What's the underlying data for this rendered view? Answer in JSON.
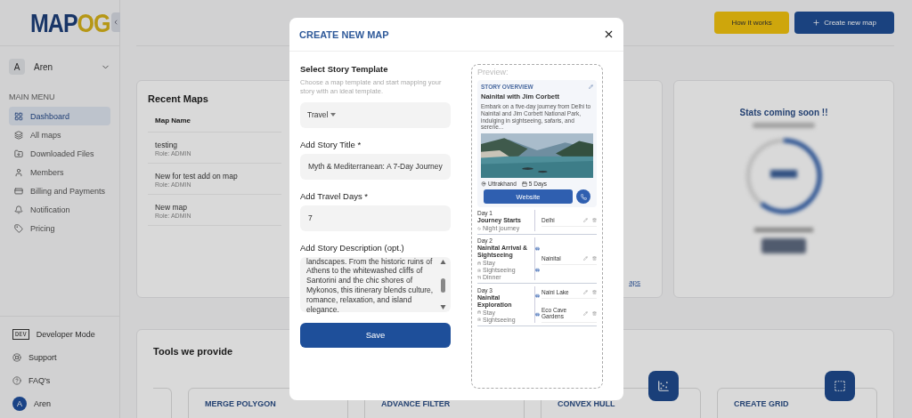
{
  "logo": {
    "main": "MAP",
    "accent": "OG"
  },
  "sidebar": {
    "user": {
      "initial": "A",
      "name": "Aren"
    },
    "section": "MAIN MENU",
    "items": [
      {
        "label": "Dashboard",
        "selected": true
      },
      {
        "label": "All maps",
        "selected": false
      },
      {
        "label": "Downloaded Files",
        "selected": false
      },
      {
        "label": "Members",
        "selected": false
      },
      {
        "label": "Billing and Payments",
        "selected": false
      },
      {
        "label": "Notification",
        "selected": false
      },
      {
        "label": "Pricing",
        "selected": false
      }
    ],
    "bottom": [
      {
        "label": "Developer Mode",
        "kind": "badge",
        "badge": "DEV"
      },
      {
        "label": "Support",
        "kind": "icon"
      },
      {
        "label": "FAQ's",
        "kind": "icon"
      },
      {
        "label": "Aren",
        "kind": "avatar",
        "badge": "A"
      }
    ]
  },
  "header": {
    "buttons": [
      {
        "label": "How it works",
        "kind": "secondary"
      },
      {
        "label": "Create new map",
        "kind": "primary"
      }
    ]
  },
  "recent_maps": {
    "title": "Recent Maps",
    "column": "Map Name",
    "rows": [
      {
        "name": "testing",
        "role": "Role: ADMIN"
      },
      {
        "name": "New for test add on map",
        "role": "Role: ADMIN"
      },
      {
        "name": "New map",
        "role": "Role: ADMIN"
      }
    ],
    "link": "aps"
  },
  "stats": {
    "title": "Stats coming soon !!"
  },
  "tools": {
    "title": "Tools we provide",
    "items": [
      {
        "name": "MERGE POLYGON"
      },
      {
        "name": "ADVANCE FILTER"
      },
      {
        "name": "CONVEX HULL"
      },
      {
        "name": "CREATE GRID"
      }
    ]
  },
  "modal": {
    "title": "CREATE NEW MAP",
    "template": {
      "label": "Select Story Template",
      "hint": "Choose a map template and start mapping your story with an ideal template.",
      "value": "Travel"
    },
    "fields": [
      {
        "label": "Add Story Title *",
        "value": "Myth & Mediterranean: A 7-Day Journey"
      },
      {
        "label": "Add Travel Days *",
        "value": "7"
      }
    ],
    "description": {
      "label": "Add Story Description (opt.)",
      "value": "landscapes. From the historic ruins of Athens to the whitewashed cliffs of Santorini and the chic shores of Mykonos, this itinerary blends culture, romance, relaxation, and island elegance."
    },
    "save": "Save",
    "preview": {
      "label": "Preview:",
      "overview": "STORY OVERVIEW",
      "title": "Nainital with Jim Corbett",
      "text": "Embark on a five-day journey from Delhi to Nainital and Jim Corbett National Park, indulging in sightseeing, safaris, and serene...",
      "location": "Uttrakhand",
      "duration": "5 Days",
      "button": "Website",
      "days": [
        {
          "day": "Day 1",
          "title": "Journey Starts",
          "tags": [
            {
              "label": "Night journey",
              "kind": "travel"
            }
          ],
          "stops": [
            "Delhi"
          ]
        },
        {
          "day": "Day 2",
          "title": "Nainital Arrival & Sightseeing",
          "tags": [
            {
              "label": "Stay",
              "kind": "stay"
            },
            {
              "label": "Sightseeing",
              "kind": "sightseeing"
            },
            {
              "label": "Dinner",
              "kind": "meal"
            }
          ],
          "stops": [
            "Nainital"
          ]
        },
        {
          "day": "Day 3",
          "title": "Nainital Exploration",
          "tags": [
            {
              "label": "Stay",
              "kind": "stay"
            },
            {
              "label": "Sightseeing",
              "kind": "sightseeing"
            }
          ],
          "stops": [
            "Naini Lake",
            "Eco Cave Gardens"
          ]
        }
      ]
    }
  }
}
